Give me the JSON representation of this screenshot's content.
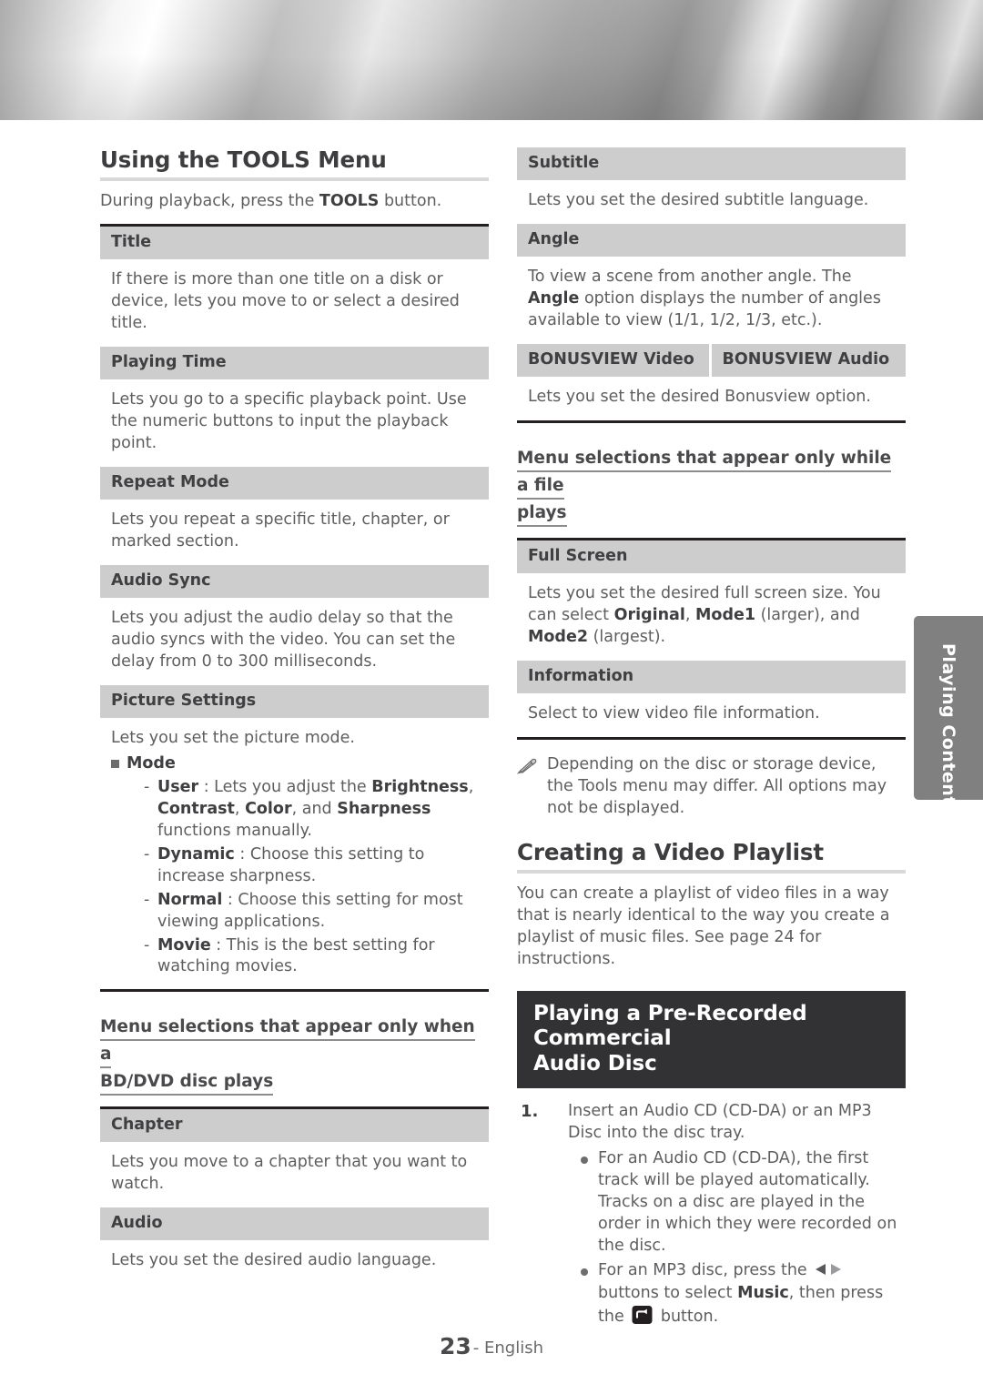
{
  "banner": {
    "name": "decorative-metallic-header-image"
  },
  "side_tab": {
    "label": "Playing Content"
  },
  "footer": {
    "page_number": "23",
    "separator": "- English"
  },
  "left_column": {
    "section_title": "Using the TOOLS Menu",
    "intro_before": "During playback, press the ",
    "intro_bold": "TOOLS",
    "intro_after": " button.",
    "table_one": [
      {
        "header": "Title",
        "body": "If there is more than one title on a disk or device, lets you move to or select a desired title."
      },
      {
        "header": "Playing Time",
        "body": "Lets you go to a specific playback point. Use the numeric buttons to input the playback point."
      },
      {
        "header": "Repeat Mode",
        "body": "Lets you repeat a specific title, chapter, or marked section."
      },
      {
        "header": "Audio Sync",
        "body": "Lets you adjust the audio delay so that the audio syncs with the video. You can set the delay from 0 to 300 milliseconds."
      }
    ],
    "picture_settings": {
      "header": "Picture Settings",
      "intro": "Lets you set the picture mode.",
      "mode_label": "Mode",
      "modes": [
        {
          "name": "User",
          "sep": " : ",
          "text_1": "Lets you adjust the ",
          "b1": "Brightness",
          "t2": ", ",
          "b2": "Contrast",
          "t3": ", ",
          "b3": "Color",
          "t4": ", and ",
          "b4": "Sharpness",
          "t5": " functions manually."
        },
        {
          "name": "Dynamic",
          "sep": " : ",
          "text": "Choose this setting to increase sharpness."
        },
        {
          "name": "Normal",
          "sep": " : ",
          "text": "Choose this setting for most viewing applications."
        },
        {
          "name": "Movie",
          "sep": " : ",
          "text": "This is the best setting for watching movies."
        }
      ]
    },
    "subsection_title_line1": "Menu selections that appear only when a",
    "subsection_title_line2": "BD/DVD disc plays",
    "table_two": [
      {
        "header": "Chapter",
        "body": "Lets you move to a chapter that you want to watch."
      },
      {
        "header": "Audio",
        "body": "Lets you set the desired audio language."
      }
    ]
  },
  "right_column": {
    "table_one": [
      {
        "header": "Subtitle",
        "body": "Lets you set the desired subtitle language."
      }
    ],
    "angle": {
      "header": "Angle",
      "t1": "To view a scene from another angle. The ",
      "b1": "Angle",
      "t2": " option displays the number of angles available to view (1/1, 1/2, 1/3, etc.)."
    },
    "bonusview": {
      "header_left": "BONUSVIEW Video",
      "header_right": "BONUSVIEW Audio",
      "body": "Lets you set the desired Bonusview option."
    },
    "subsection_title_line1": "Menu selections that appear only while a file",
    "subsection_title_line2": "plays",
    "full_screen": {
      "header": "Full Screen",
      "t1": "Lets you set the desired full screen size. You can select ",
      "b1": "Original",
      "t2": ", ",
      "b2": "Mode1",
      "t3": " (larger), and ",
      "b3": "Mode2",
      "t4": " (largest)."
    },
    "information": {
      "header": "Information",
      "body": "Select to view video file information."
    },
    "note": "Depending on the disc or storage device, the Tools menu may differ. All options may not be displayed.",
    "playlist_section_title": "Creating a Video Playlist",
    "playlist_body": "You can create a playlist of video files in a way that is nearly identical to the way you create a playlist of music files. See page 24 for instructions.",
    "audio_disc_heading_line1": "Playing a Pre-Recorded Commercial",
    "audio_disc_heading_line2": "Audio Disc",
    "step_one": {
      "num": "1.",
      "text": "Insert an Audio CD (CD-DA) or an MP3 Disc into the disc tray.",
      "bullets": [
        {
          "text": "For an Audio CD (CD-DA), the first track will be played automatically. Tracks on a disc are played in the order in which they were recorded on the disc."
        }
      ],
      "mp3_bullet": {
        "t1": "For an MP3 disc, press the ",
        "icon_arrows": "left-right-arrow-buttons-icon",
        "t2": " buttons to select ",
        "b1": "Music",
        "t3": ", then press the ",
        "icon_enter": "enter-button-icon",
        "t4": " button."
      }
    }
  }
}
